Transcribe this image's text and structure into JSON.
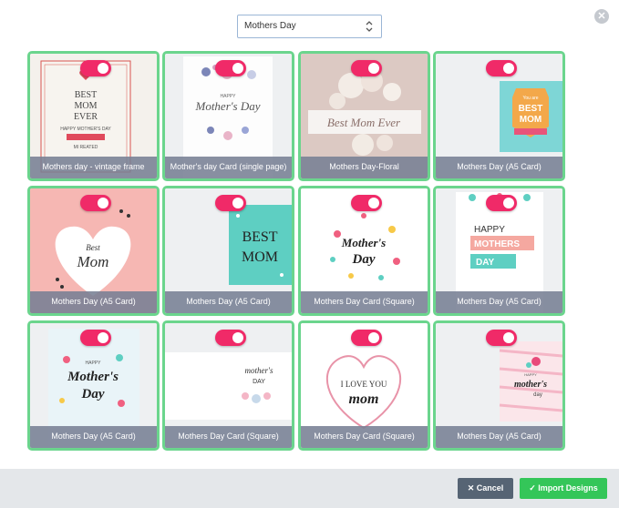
{
  "select": {
    "value": "Mothers Day"
  },
  "footer": {
    "cancel_label": "Cancel",
    "import_label": "Import Designs"
  },
  "colors": {
    "accent_green": "#6bd58d",
    "toggle_pink": "#f02a68",
    "import_green": "#34c659",
    "cancel_gray": "#566474"
  },
  "designs": [
    {
      "title": "Mothers day - vintage frame",
      "art": [
        "BEST",
        "MOM",
        "EVER",
        "HAPPY MOTHER'S DAY",
        "MI REATED"
      ]
    },
    {
      "title": "Mother's day Card (single page)",
      "art": [
        "HAPPY",
        "Mother's Day"
      ]
    },
    {
      "title": "Mothers Day-Floral",
      "art": [
        "Best Mom Ever"
      ]
    },
    {
      "title": "Mothers Day (A5 Card)",
      "art": [
        "You are",
        "BEST",
        "MOM"
      ]
    },
    {
      "title": "Mothers Day (A5 Card)",
      "art": [
        "Best",
        "Mom"
      ]
    },
    {
      "title": "Mothers Day (A5 Card)",
      "art": [
        "BEST",
        "MOM"
      ]
    },
    {
      "title": "Mothers Day Card (Square)",
      "art": [
        "Mother's",
        "Day"
      ]
    },
    {
      "title": "Mothers Day (A5 Card)",
      "art": [
        "HAPPY",
        "MOTHERS",
        "DAY"
      ]
    },
    {
      "title": "Mothers Day (A5 Card)",
      "art": [
        "HAPPY",
        "Mother's",
        "Day"
      ]
    },
    {
      "title": "Mothers Day Card (Square)",
      "art": [
        "mother's",
        "DAY"
      ]
    },
    {
      "title": "Mothers Day Card (Square)",
      "art": [
        "I LOVE YOU",
        "mom"
      ]
    },
    {
      "title": "Mothers Day (A5 Card)",
      "art": [
        "HAPPY",
        "mother's",
        "day"
      ]
    }
  ]
}
